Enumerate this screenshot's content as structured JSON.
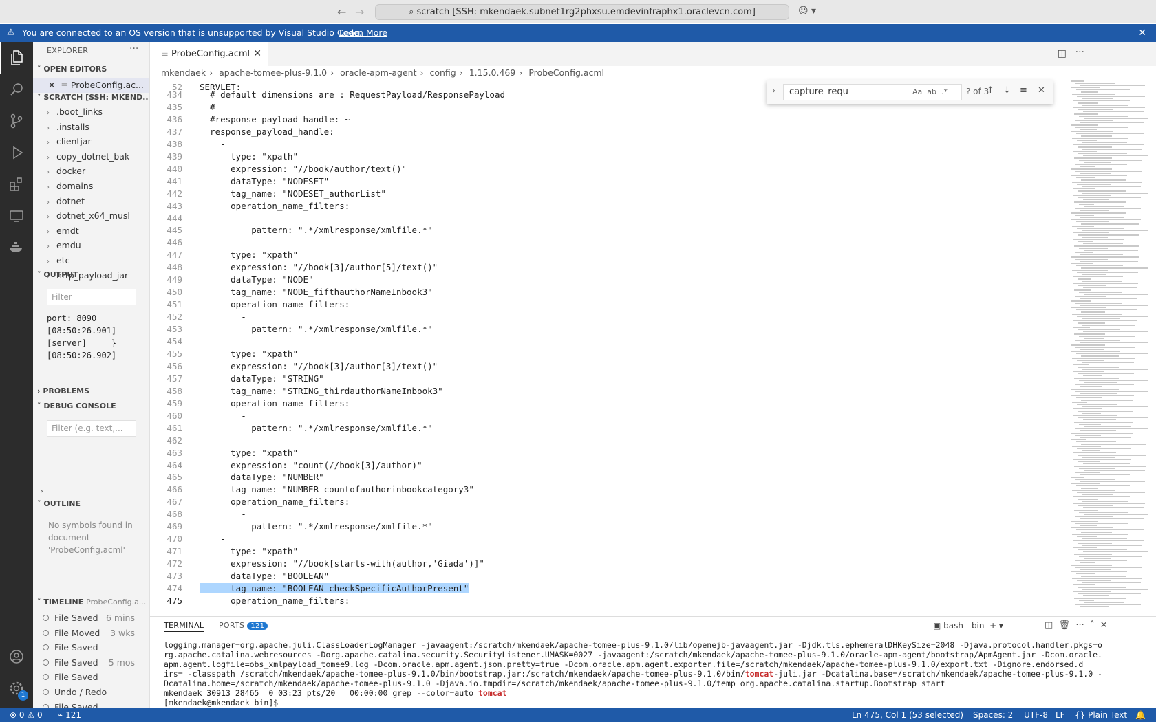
{
  "titlebar": {
    "search_text": "scratch [SSH: mkendaek.subnet1rg2phxsu.emdevinfraphx1.oraclevcn.com]"
  },
  "banner": {
    "message": "You are connected to an OS version that is unsupported by Visual Studio Code.",
    "link": "Learn More"
  },
  "sidebar": {
    "explorer_title": "EXPLORER",
    "open_editors_title": "OPEN EDITORS",
    "open_editor_item": "ProbeConfig.ac...",
    "workspace_title": "SCRATCH [SSH: MKEND...",
    "tree": [
      ".boot_links",
      ".installs",
      "clientjar",
      "copy_dotnet_bak",
      "docker",
      "domains",
      "dotnet",
      "dotnet_x64_musl",
      "emdt",
      "emdu",
      "etc",
      "http_payload_jar"
    ],
    "output_title": "OUTPUT",
    "output_filter": "Filter",
    "output_lines": [
      "port: 8090",
      "[08:50:26.901]",
      "[server]     }",
      "[08:50:26.902]"
    ],
    "problems_title": "PROBLEMS",
    "debug_title": "DEBUG CONSOLE",
    "debug_filter": "Filter (e.g. text,...",
    "outline_title": "OUTLINE",
    "outline_empty": "No symbols found in document 'ProbeConfig.acml'",
    "timeline_title": "TIMELINE",
    "timeline_file": "ProbeConfig.a...",
    "timeline": [
      {
        "label": "File Saved",
        "time": "6 mins"
      },
      {
        "label": "File Moved",
        "time": "3 wks"
      },
      {
        "label": "File Saved",
        "time": ""
      },
      {
        "label": "File Saved",
        "time": "5 mos"
      },
      {
        "label": "File Saved",
        "time": ""
      },
      {
        "label": "Undo / Redo",
        "time": ""
      },
      {
        "label": "File Saved",
        "time": ""
      }
    ]
  },
  "editor": {
    "tab_label": "ProbeConfig.acml",
    "breadcrumb": [
      "mkendaek",
      "apache-tomee-plus-9.1.0",
      "oracle-apm-agent",
      "config",
      "1.15.0.469",
      "ProbeConfig.acml"
    ],
    "sticky_line": {
      "num": "52",
      "text": "SERVLET:"
    },
    "find_query": "capture_requ",
    "find_count": "? of 3",
    "lines": [
      {
        "num": "434",
        "text": "  # default dimensions are : RequestPayload/ResponsePayload"
      },
      {
        "num": "435",
        "text": "  #"
      },
      {
        "num": "436",
        "text": "  #response_payload_handle: ~"
      },
      {
        "num": "437",
        "text": "  response_payload_handle:"
      },
      {
        "num": "438",
        "text": "    -"
      },
      {
        "num": "439",
        "text": "      type: \"xpath\""
      },
      {
        "num": "440",
        "text": "      expression: \"//book/author/text()\""
      },
      {
        "num": "441",
        "text": "      dataType: \"NODESET\""
      },
      {
        "num": "442",
        "text": "      tag_name: \"NODESET_authorList\""
      },
      {
        "num": "443",
        "text": "      operation_name_filters:"
      },
      {
        "num": "444",
        "text": "        -"
      },
      {
        "num": "445",
        "text": "          pattern: \".*/xmlresponse/xmlfile.*\""
      },
      {
        "num": "446",
        "text": "    -"
      },
      {
        "num": "447",
        "text": "      type: \"xpath\""
      },
      {
        "num": "448",
        "text": "      expression: \"//book[3]/author[5]/text()\""
      },
      {
        "num": "449",
        "text": "      dataType: \"NODE\""
      },
      {
        "num": "450",
        "text": "      tag_name: \"NODE_fifthauthorNameInbook3\""
      },
      {
        "num": "451",
        "text": "      operation_name_filters:"
      },
      {
        "num": "452",
        "text": "        -"
      },
      {
        "num": "453",
        "text": "          pattern: \".*/xmlresponse/xmlfile.*\""
      },
      {
        "num": "454",
        "text": "    -"
      },
      {
        "num": "455",
        "text": "      type: \"xpath\""
      },
      {
        "num": "456",
        "text": "      expression: \"//book[3]/author[3]/text()\""
      },
      {
        "num": "457",
        "text": "      dataType: \"STRING\""
      },
      {
        "num": "458",
        "text": "      tag_name: \"STRING_thirdauthorNameInbook3\""
      },
      {
        "num": "459",
        "text": "      operation_name_filters:"
      },
      {
        "num": "460",
        "text": "        -"
      },
      {
        "num": "461",
        "text": "          pattern: \".*/xmlresponse/xmlfile.*\""
      },
      {
        "num": "462",
        "text": "    -"
      },
      {
        "num": "463",
        "text": "      type: \"xpath\""
      },
      {
        "num": "464",
        "text": "      expression: \"count(//book[3]/author)\""
      },
      {
        "num": "465",
        "text": "      dataType: \"NUMBER\""
      },
      {
        "num": "466",
        "text": "      tag_name: \"NUMBER_countofauthorinbookcategory3\""
      },
      {
        "num": "467",
        "text": "      operation_name_filters:"
      },
      {
        "num": "468",
        "text": "        -"
      },
      {
        "num": "469",
        "text": "          pattern: \".*/xmlresponse/xmlfile.*\""
      },
      {
        "num": "470",
        "text": "    -"
      },
      {
        "num": "471",
        "text": "      type: \"xpath\""
      },
      {
        "num": "472",
        "text": "      expression: \"//book[starts-with(author,'Giada')]\""
      },
      {
        "num": "473",
        "text": "      dataType: \"BOOLEAN\""
      },
      {
        "num": "474",
        "text": "      tag_name: \"BOOLEAN_checkSpecificAuthorPresent\""
      },
      {
        "num": "475",
        "text": "      operation_name_filters:"
      }
    ]
  },
  "panel": {
    "terminal_tab": "TERMINAL",
    "ports_tab": "PORTS",
    "ports_count": "121",
    "shell_label": "bash - bin",
    "term_lines": [
      "logging.manager=org.apache.juli.ClassLoaderLogManager -javaagent:/scratch/mkendaek/apache-tomee-plus-9.1.0/lib/openejb-javaagent.jar -Djdk.tls.ephemeralDHKeySize=2048 -Djava.protocol.handler.pkgs=o",
      "rg.apache.catalina.webresources -Dorg.apache.catalina.security.SecurityListener.UMASK=0027 -javaagent:/scratch/mkendaek/apache-tomee-plus-9.1.0/oracle-apm-agent/bootstrap/ApmAgent.jar -Dcom.oracle.",
      "apm.agent.logfile=obs_xmlpayload_tomee9.log -Dcom.oracle.apm.agent.json.pretty=true -Dcom.oracle.apm.agent.exporter.file=/scratch/mkendaek/apache-tomee-plus-9.1.0/export.txt -Dignore.endorsed.d",
      "irs= -classpath /scratch/mkendaek/apache-tomee-plus-9.1.0/bin/bootstrap.jar:/scratch/mkendaek/apache-tomee-plus-9.1.0/bin/",
      "Dcatalina.home=/scratch/mkendaek/apache-tomee-plus-9.1.0 -Djava.io.tmpdir=/scratch/mkendaek/apache-tomee-plus-9.1.0/temp org.apache.catalina.startup.Bootstrap start",
      "mkendaek 30913 28465  0 03:23 pts/20   00:00:00 grep --color=auto ",
      "[mkendaek@mkendaek bin]$ "
    ],
    "term_line4_red": "tomcat",
    "term_line4_rest": "-juli.jar -Dcatalina.base=/scratch/mkendaek/apache-tomee-plus-9.1.0 -",
    "term_line6_red": "tomcat"
  },
  "statusbar": {
    "errors": "0",
    "warnings": "0",
    "ports": "121",
    "position": "Ln 475, Col 1 (53 selected)",
    "spaces": "Spaces: 2",
    "encoding": "UTF-8",
    "eol": "LF",
    "language": "Plain Text"
  },
  "colors": {
    "accent": "#1f5aa8",
    "selection": "#add6ff",
    "activitybar": "#2c2c2c"
  }
}
